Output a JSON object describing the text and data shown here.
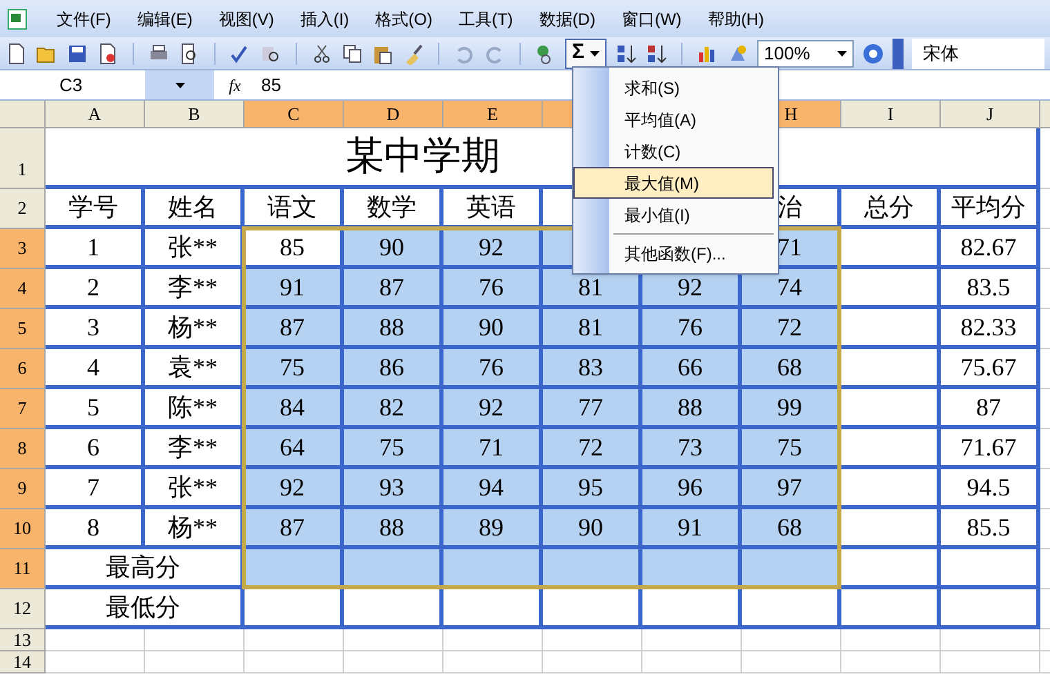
{
  "menu_bar": [
    "文件(F)",
    "编辑(E)",
    "视图(V)",
    "插入(I)",
    "格式(O)",
    "工具(T)",
    "数据(D)",
    "窗口(W)",
    "帮助(H)"
  ],
  "toolbar": {
    "autosum": "Σ",
    "autosum_pressed": true,
    "zoom": "100%",
    "font": "宋体"
  },
  "formula_bar": {
    "name_box": "C3",
    "fx": "fx",
    "value": "85"
  },
  "columns": [
    {
      "label": "A",
      "selected": false
    },
    {
      "label": "B",
      "selected": false
    },
    {
      "label": "C",
      "selected": true
    },
    {
      "label": "D",
      "selected": true
    },
    {
      "label": "E",
      "selected": true
    },
    {
      "selected": true
    },
    {},
    {
      "label": "H",
      "selected": true
    },
    {
      "label": "I",
      "selected": false
    },
    {
      "label": "J",
      "selected": false
    }
  ],
  "title_row": {
    "number": "1",
    "selected": false,
    "title": "某中学期"
  },
  "rows": [
    {
      "number": "2",
      "selected": false,
      "kind": "data",
      "cells": [
        "学号",
        "姓名",
        "语文",
        "数学",
        "英语",
        null,
        null,
        "治",
        "总分",
        "平均分"
      ]
    },
    {
      "number": "3",
      "selected": true,
      "kind": "data",
      "cells": [
        "1",
        "张**",
        "85",
        "90",
        "92",
        null,
        null,
        "71",
        null,
        "82.67"
      ]
    },
    {
      "number": "4",
      "selected": true,
      "kind": "data",
      "cells": [
        "2",
        "李**",
        "91",
        "87",
        "76",
        "81",
        "92",
        "74",
        null,
        "83.5"
      ]
    },
    {
      "number": "5",
      "selected": true,
      "kind": "data",
      "cells": [
        "3",
        "杨**",
        "87",
        "88",
        "90",
        "81",
        "76",
        "72",
        null,
        "82.33"
      ]
    },
    {
      "number": "6",
      "selected": true,
      "kind": "data",
      "cells": [
        "4",
        "袁**",
        "75",
        "86",
        "76",
        "83",
        "66",
        "68",
        null,
        "75.67"
      ]
    },
    {
      "number": "7",
      "selected": true,
      "kind": "data",
      "cells": [
        "5",
        "陈**",
        "84",
        "82",
        "92",
        "77",
        "88",
        "99",
        null,
        "87"
      ]
    },
    {
      "number": "8",
      "selected": true,
      "kind": "data",
      "cells": [
        "6",
        "李**",
        "64",
        "75",
        "71",
        "72",
        "73",
        "75",
        null,
        "71.67"
      ]
    },
    {
      "number": "9",
      "selected": true,
      "kind": "data",
      "cells": [
        "7",
        "张**",
        "92",
        "93",
        "94",
        "95",
        "96",
        "97",
        null,
        "94.5"
      ]
    },
    {
      "number": "10",
      "selected": true,
      "kind": "data",
      "cells": [
        "8",
        "杨**",
        "87",
        "88",
        "89",
        "90",
        "91",
        "68",
        null,
        "85.5"
      ]
    },
    {
      "number": "11",
      "selected": true,
      "kind": "summary",
      "label": "最高分"
    },
    {
      "number": "12",
      "selected": false,
      "kind": "summary",
      "label": "最低分"
    },
    {
      "number": "13",
      "selected": false,
      "kind": "empty"
    },
    {
      "number": "14",
      "selected": false,
      "kind": "empty"
    }
  ],
  "autosum_menu": [
    {
      "label": "求和(S)",
      "selected": false
    },
    {
      "label": "平均值(A)",
      "selected": false
    },
    {
      "label": "计数(C)",
      "selected": false
    },
    {
      "label": "最大值(M)",
      "selected": true
    },
    {
      "label": "最小值(I)",
      "selected": false
    },
    {
      "label": "其他函数(F)...",
      "selected": false,
      "separator_before": true
    }
  ]
}
